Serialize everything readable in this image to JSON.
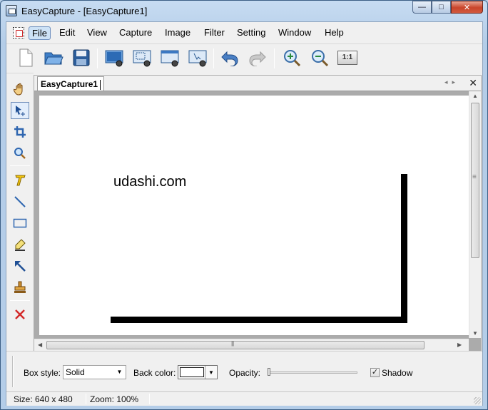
{
  "window": {
    "title": "EasyCapture - [EasyCapture1]",
    "minimize_glyph": "—",
    "maximize_glyph": "□",
    "close_glyph": "✕"
  },
  "menu": {
    "items": [
      {
        "label": "File",
        "active": true
      },
      {
        "label": "Edit"
      },
      {
        "label": "View"
      },
      {
        "label": "Capture"
      },
      {
        "label": "Image"
      },
      {
        "label": "Filter"
      },
      {
        "label": "Setting"
      },
      {
        "label": "Window"
      },
      {
        "label": "Help"
      }
    ]
  },
  "toolbar": {
    "buttons": [
      {
        "icon": "new-document-icon"
      },
      {
        "icon": "open-folder-icon"
      },
      {
        "icon": "save-disk-icon"
      },
      {
        "icon": "capture-fullscreen-icon"
      },
      {
        "icon": "capture-region-icon"
      },
      {
        "icon": "capture-window-icon"
      },
      {
        "icon": "capture-object-icon"
      },
      {
        "icon": "undo-icon"
      },
      {
        "icon": "redo-icon"
      },
      {
        "icon": "zoom-in-icon"
      },
      {
        "icon": "zoom-out-icon"
      },
      {
        "icon": "actual-size-icon",
        "label": "1:1"
      }
    ]
  },
  "tools": [
    {
      "icon": "hand-icon"
    },
    {
      "icon": "select-pointer-icon",
      "active": true
    },
    {
      "icon": "crop-icon"
    },
    {
      "icon": "magnifier-icon"
    },
    {
      "icon": "text-tool-icon"
    },
    {
      "icon": "line-tool-icon"
    },
    {
      "icon": "rectangle-tool-icon"
    },
    {
      "icon": "highlighter-icon"
    },
    {
      "icon": "arrow-tool-icon"
    },
    {
      "icon": "stamp-icon"
    },
    {
      "icon": "delete-icon"
    }
  ],
  "document": {
    "tab_label": "EasyCapture1",
    "nav_left": "◂",
    "nav_right": "▸",
    "close_glyph": "✕",
    "canvas_text": "udashi.com"
  },
  "properties": {
    "box_style_label": "Box style:",
    "box_style_value": "Solid",
    "back_color_label": "Back color:",
    "back_color_value": "#ffffff",
    "opacity_label": "Opacity:",
    "opacity_value": 0,
    "shadow_label": "Shadow",
    "shadow_checked": true,
    "dropdown_glyph": "▼",
    "check_glyph": "✓"
  },
  "status": {
    "size": "Size: 640 x 480",
    "zoom": "Zoom: 100%"
  }
}
